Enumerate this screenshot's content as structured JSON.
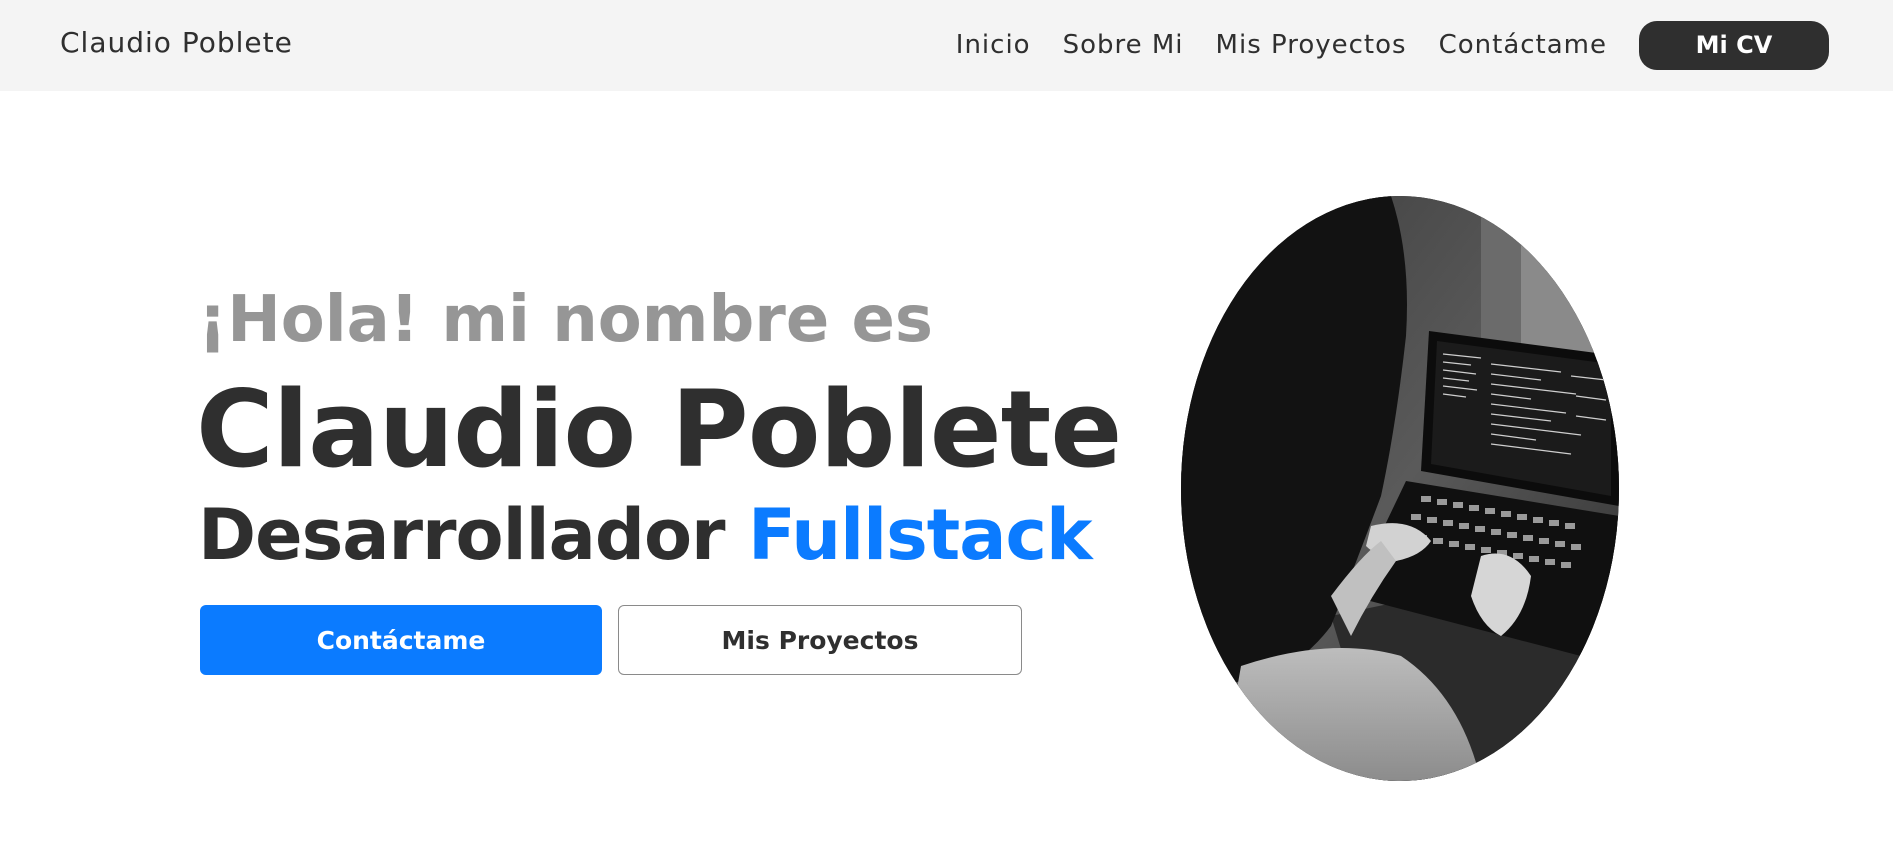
{
  "navbar": {
    "brand": "Claudio Poblete",
    "links": [
      "Inicio",
      "Sobre Mi",
      "Mis Proyectos",
      "Contáctame"
    ],
    "cv_button": "Mi CV"
  },
  "hero": {
    "greeting": "¡Hola! mi nombre es",
    "name": "Claudio Poblete",
    "role_prefix": "Desarrollador",
    "role_highlight": "Fullstack",
    "primary_button": "Contáctame",
    "secondary_button": "Mis Proyectos",
    "photo": "black-and-white photo of person coding on laptop"
  },
  "colors": {
    "accent": "#0b7bff",
    "dark": "#2f2f2f",
    "muted": "#969696",
    "navbar_bg": "#f4f4f4"
  }
}
